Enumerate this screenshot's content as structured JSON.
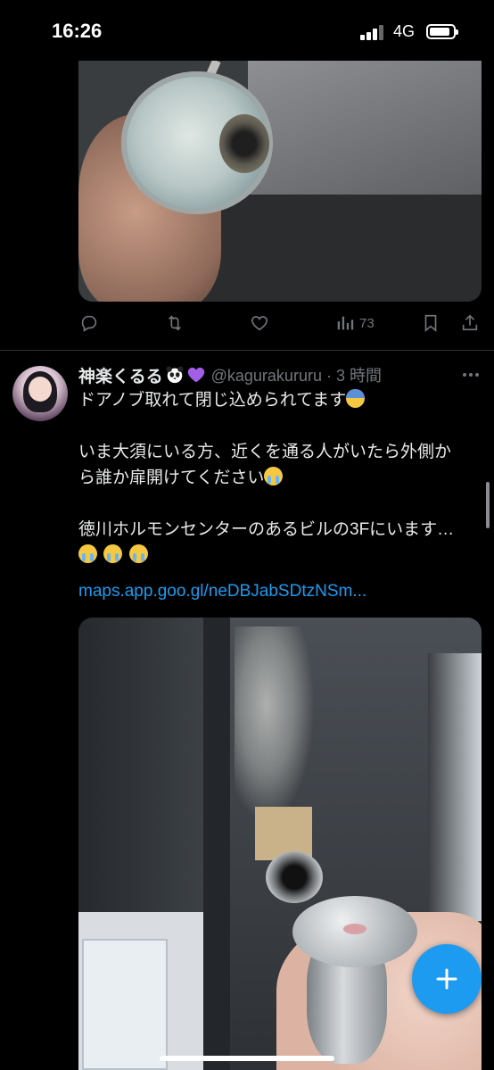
{
  "status_bar": {
    "time": "16:26",
    "network": "4G"
  },
  "prev_tweet": {
    "actions": {
      "views": "73"
    }
  },
  "tweet": {
    "display_name": "神楽くるる",
    "handle_time": "@kagurakururu · 3 時間",
    "lines": [
      "ドアノブ取れて閉じ込められてます",
      "いま大須にいる方、近くを通る人がいたら外側か",
      "ら誰か扉開けてください",
      "徳川ホルモンセンターのあるビルの3Fにいます…"
    ],
    "link": "maps.app.goo.gl/neDBJabSDtzNSm..."
  },
  "icons": {
    "reply": "reply-icon",
    "retweet": "retweet-icon",
    "like": "like-icon",
    "views": "views-icon",
    "bookmark": "bookmark-icon",
    "share": "share-icon",
    "more": "more-icon",
    "compose": "compose-plus-icon"
  },
  "colors": {
    "accent": "#1d9bf0",
    "muted": "#71767b",
    "text": "#e7e9ea",
    "background": "#000000"
  }
}
